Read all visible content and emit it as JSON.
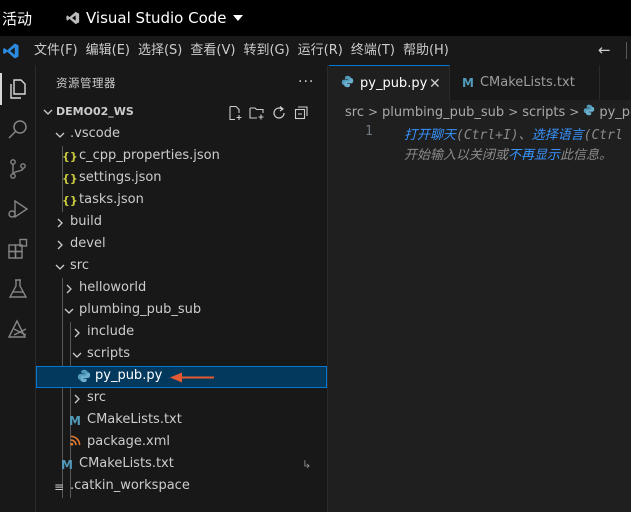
{
  "topbar": {
    "activities": "活动",
    "app_name": "Visual Studio Code"
  },
  "menu": [
    "文件(F)",
    "编辑(E)",
    "选择(S)",
    "查看(V)",
    "转到(G)",
    "运行(R)",
    "终端(T)",
    "帮助(H)"
  ],
  "nav": {
    "back": "←"
  },
  "explorer": {
    "title": "资源管理器",
    "more": "···",
    "workspace": "DEMO02_WS",
    "items": [
      {
        "label": ".vscode",
        "type": "folder",
        "expanded": true
      },
      {
        "label": "c_cpp_properties.json",
        "type": "json",
        "icon": "{}"
      },
      {
        "label": "settings.json",
        "type": "json",
        "icon": "{}"
      },
      {
        "label": "tasks.json",
        "type": "json",
        "icon": "{}"
      },
      {
        "label": "build",
        "type": "folder",
        "expanded": false
      },
      {
        "label": "devel",
        "type": "folder",
        "expanded": false
      },
      {
        "label": "src",
        "type": "folder",
        "expanded": true
      },
      {
        "label": "helloworld",
        "type": "folder",
        "expanded": false
      },
      {
        "label": "plumbing_pub_sub",
        "type": "folder",
        "expanded": true
      },
      {
        "label": "include",
        "type": "folder",
        "expanded": false
      },
      {
        "label": "scripts",
        "type": "folder",
        "expanded": true
      },
      {
        "label": "py_pub.py",
        "type": "python",
        "selected": true
      },
      {
        "label": "src",
        "type": "folder",
        "expanded": false
      },
      {
        "label": "CMakeLists.txt",
        "type": "cmake",
        "icon": "M"
      },
      {
        "label": "package.xml",
        "type": "xml",
        "icon": "rss"
      },
      {
        "label": "CMakeLists.txt",
        "type": "cmake",
        "icon": "M",
        "badge": "↳"
      },
      {
        "label": ".catkin_workspace",
        "type": "text",
        "icon": "≡"
      }
    ]
  },
  "tabs": [
    {
      "label": "py_pub.py",
      "active": true,
      "close": "✕"
    },
    {
      "label": "CMakeLists.txt",
      "active": false
    }
  ],
  "breadcrumb": [
    "src",
    "plumbing_pub_sub",
    "scripts",
    "py_pub.py"
  ],
  "editor": {
    "line_number": "1",
    "hint_line1": {
      "link1": "打开聊天",
      "text1": "(Ctrl+I)、",
      "link2": "选择语言",
      "text2": "(Ctrl"
    },
    "hint_line2": {
      "text1": "开始输入以关闭或",
      "link": "不再显示",
      "text2": "此信息。"
    }
  },
  "colors": {
    "accent": "#0078d4",
    "selected_bg": "#04395e",
    "json_icon": "#cbcb41",
    "python_icon": "#519aba",
    "cmake_icon": "#519aba",
    "xml_icon": "#e37933",
    "arrow": "#e45a33"
  }
}
